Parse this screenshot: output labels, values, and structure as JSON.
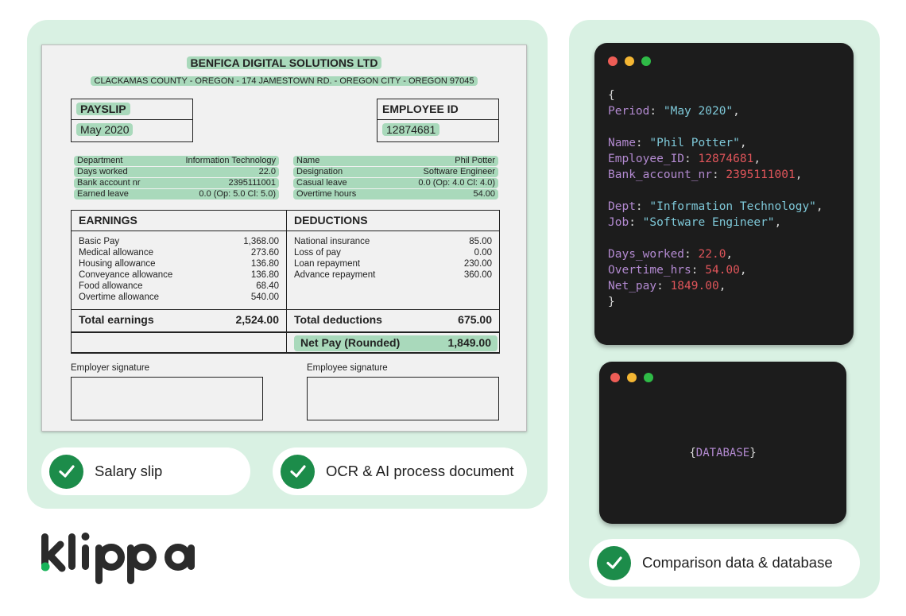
{
  "payslip": {
    "company": "BENFICA DIGITAL SOLUTIONS LTD",
    "address": "CLACKAMAS COUNTY - OREGON - 174 JAMESTOWN RD. - OREGON CITY - OREGON 97045",
    "payslip_label": "PAYSLIP",
    "period": "May 2020",
    "employee_id_label": "EMPLOYEE ID",
    "employee_id": "12874681",
    "left_info": [
      {
        "label": "Department",
        "value": "Information Technology"
      },
      {
        "label": "Days worked",
        "value": "22.0"
      },
      {
        "label": "Bank account nr",
        "value": "2395111001"
      },
      {
        "label": "Earned leave",
        "value": "0.0 (Op: 5.0 Cl: 5.0)"
      }
    ],
    "right_info": [
      {
        "label": "Name",
        "value": "Phil Potter"
      },
      {
        "label": "Designation",
        "value": "Software Engineer"
      },
      {
        "label": "Casual leave",
        "value": "0.0 (Op: 4.0 Cl: 4.0)"
      },
      {
        "label": "Overtime hours",
        "value": "54.00"
      }
    ],
    "earnings_header": "EARNINGS",
    "earnings": [
      {
        "label": "Basic Pay",
        "value": "1,368.00"
      },
      {
        "label": "Medical allowance",
        "value": "273.60"
      },
      {
        "label": "Housing allowance",
        "value": "136.80"
      },
      {
        "label": "Conveyance allowance",
        "value": "136.80"
      },
      {
        "label": "Food allowance",
        "value": "68.40"
      },
      {
        "label": "Overtime allowance",
        "value": "540.00"
      }
    ],
    "total_earnings_label": "Total earnings",
    "total_earnings": "2,524.00",
    "deductions_header": "DEDUCTIONS",
    "deductions": [
      {
        "label": "National insurance",
        "value": "85.00"
      },
      {
        "label": "Loss of pay",
        "value": "0.00"
      },
      {
        "label": "Loan repayment",
        "value": "230.00"
      },
      {
        "label": "Advance repayment",
        "value": "360.00"
      }
    ],
    "total_deductions_label": "Total deductions",
    "total_deductions": "675.00",
    "net_pay_label": "Net Pay (Rounded)",
    "net_pay": "1,849.00",
    "employer_signature_label": "Employer signature",
    "employee_signature_label": "Employee signature"
  },
  "steps": {
    "salary_slip": "Salary slip",
    "ocr": "OCR & AI process document",
    "comparison": "Comparison data & database"
  },
  "code": {
    "open": "{",
    "period_key": "Period",
    "period_val": "\"May 2020\"",
    "name_key": "Name",
    "name_val": "\"Phil Potter\"",
    "employee_id_key": "Employee_ID",
    "employee_id_val": "12874681",
    "bank_key": "Bank_account_nr",
    "bank_val": "2395111001",
    "dept_key": "Dept",
    "dept_val": "\"Information Technology\"",
    "job_key": "Job",
    "job_val": "\"Software Engineer\"",
    "days_key": "Days_worked",
    "days_val": "22.0",
    "overtime_key": "Overtime_hrs",
    "overtime_val": "54.00",
    "netpay_key": "Net_pay",
    "netpay_val": "1849.00",
    "close": "}"
  },
  "database": {
    "open": "{",
    "label": "DATABASE",
    "close": "}"
  },
  "logo": {
    "text": "klippa"
  },
  "colors": {
    "panel_bg": "#d9f1e3",
    "highlight": "#a9d9bb",
    "check": "#1c8c4a",
    "terminal_bg": "#1c1c1c",
    "dot_red": "#ee5d56",
    "dot_yellow": "#f4b633",
    "dot_green": "#2fbb47",
    "logo_dot": "#18b35a",
    "logo_text": "#2b2b2b"
  },
  "icons": [
    "check-icon",
    "window-dots"
  ]
}
